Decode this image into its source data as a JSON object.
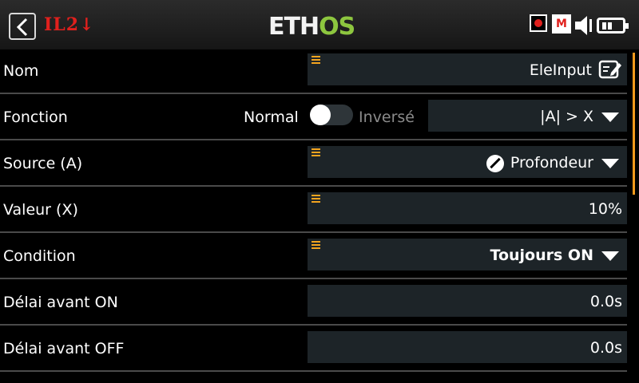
{
  "header": {
    "model_name": "IL2↓",
    "logo_primary": "ETH",
    "logo_accent": "OS",
    "m_badge": "M"
  },
  "rows": {
    "nom": {
      "label": "Nom",
      "value": "EleInput"
    },
    "fonction": {
      "label": "Fonction",
      "toggle_off_label": "Normal",
      "toggle_on_label": "Inversé",
      "value": "|A| > X",
      "toggle_on": false
    },
    "source": {
      "label": "Source (A)",
      "value": "Profondeur"
    },
    "valeur": {
      "label": "Valeur (X)",
      "value": "10%"
    },
    "condition": {
      "label": "Condition",
      "value": "Toujours ON"
    },
    "delai_on": {
      "label": "Délai avant ON",
      "value": "0.0s"
    },
    "delai_off": {
      "label": "Délai avant OFF",
      "value": "0.0s"
    }
  },
  "colors": {
    "accent": "#f39a1c",
    "logo_green": "#8dc63f",
    "model_red": "#e0201d",
    "field_bg": "#1d2428"
  }
}
